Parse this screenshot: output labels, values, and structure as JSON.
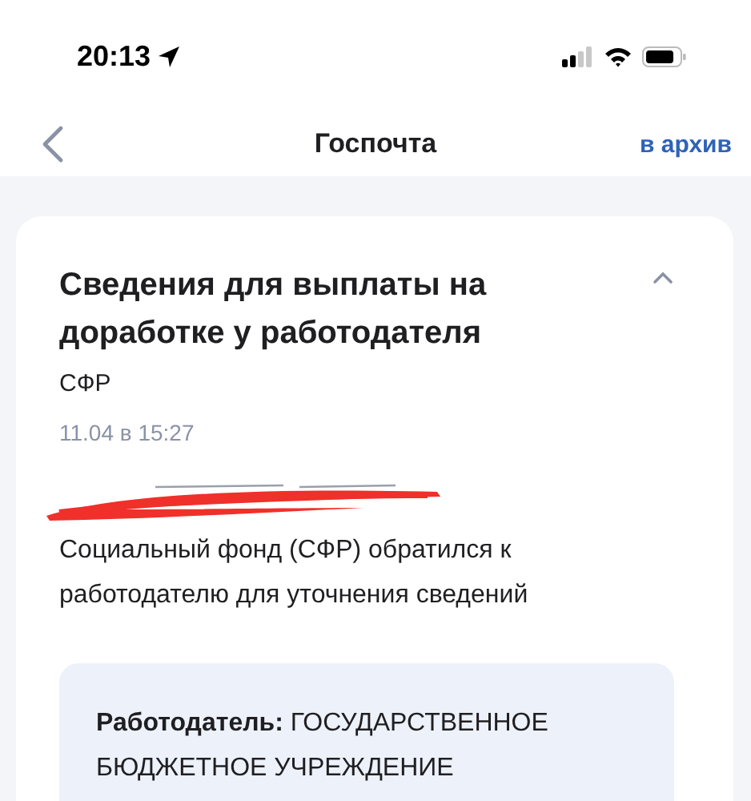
{
  "status_bar": {
    "time": "20:13"
  },
  "header": {
    "title": "Госпочта",
    "action": "в архив"
  },
  "message": {
    "expanded": true,
    "title": "Сведения для выплаты на доработке у работодателя",
    "sender": "СФР",
    "date": "11.04 в 15:27",
    "redacted": true,
    "text": "Социальный фонд (СФР) обратился к работодателю для уточнения сведений",
    "details": "**Работодатель:** ГОСУДАРСТВЕННОЕ БЮДЖЕТНОЕ УЧРЕЖДЕНИЕ"
  }
}
